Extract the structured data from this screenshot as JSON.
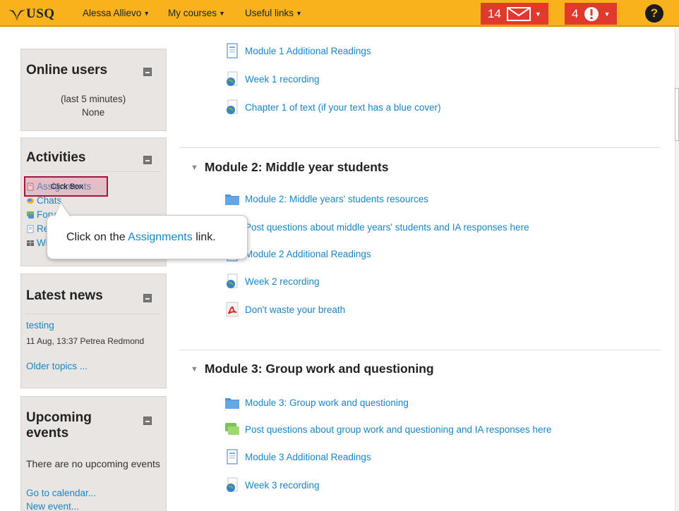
{
  "header": {
    "brand": "USQ",
    "user_menu": "Alessa Allievo",
    "courses_menu": "My courses",
    "links_menu": "Useful links",
    "messages_count": "14",
    "alerts_count": "4",
    "help_glyph": "?"
  },
  "colors": {
    "accent": "#f9b21c",
    "badge": "#e03a2f",
    "link": "#1a85c4",
    "highlight": "#a3173f"
  },
  "online_users": {
    "title": "Online users",
    "subtitle": "(last 5 minutes)",
    "value": "None"
  },
  "activities": {
    "title": "Activities",
    "items": [
      {
        "label": "Assignments",
        "icon": "assignment-icon"
      },
      {
        "label": "Chats",
        "icon": "chat-icon"
      },
      {
        "label": "Forums",
        "icon": "forum-icon"
      },
      {
        "label": "Resources",
        "icon": "resource-icon"
      },
      {
        "label": "Wikis",
        "icon": "wiki-icon"
      }
    ]
  },
  "latest_news": {
    "title": "Latest news",
    "item_title": "testing",
    "item_meta": "11 Aug, 13:37  Petrea Redmond",
    "older": "Older topics ..."
  },
  "upcoming": {
    "title_line1": "Upcoming",
    "title_line2": "events",
    "empty": "There are no upcoming events",
    "calendar": "Go to calendar...",
    "new_event": "New event..."
  },
  "module1_tail": [
    {
      "label": "Module 1 Additional Readings",
      "icon": "page-icon"
    },
    {
      "label": "Week 1 recording",
      "icon": "url-globe-icon"
    },
    {
      "label": "Chapter 1 of text (if your text has a blue cover)",
      "icon": "url-globe-icon"
    }
  ],
  "module2": {
    "title": "Module 2: Middle year students",
    "items": [
      {
        "label": "Module 2: Middle years' students resources",
        "icon": "folder-icon"
      },
      {
        "label": "Post questions about middle years' students and IA responses here",
        "icon": "forum-icon"
      },
      {
        "label": "Module 2 Additional Readings",
        "icon": "page-icon"
      },
      {
        "label": "Week 2 recording",
        "icon": "url-globe-icon"
      },
      {
        "label": "Don't waste your breath",
        "icon": "pdf-icon"
      }
    ]
  },
  "module3": {
    "title": "Module 3: Group work and questioning",
    "items": [
      {
        "label": "Module 3: Group work and questioning",
        "icon": "folder-icon"
      },
      {
        "label": "Post questions about group work and questioning and IA responses here",
        "icon": "forum-icon"
      },
      {
        "label": "Module 3 Additional Readings",
        "icon": "page-icon"
      },
      {
        "label": "Week 3 recording",
        "icon": "url-globe-icon"
      }
    ]
  },
  "tutorial": {
    "clickbox_label": "Click Box",
    "callout_before": "Click on the ",
    "callout_highlight": "Assignments",
    "callout_after": " link."
  }
}
